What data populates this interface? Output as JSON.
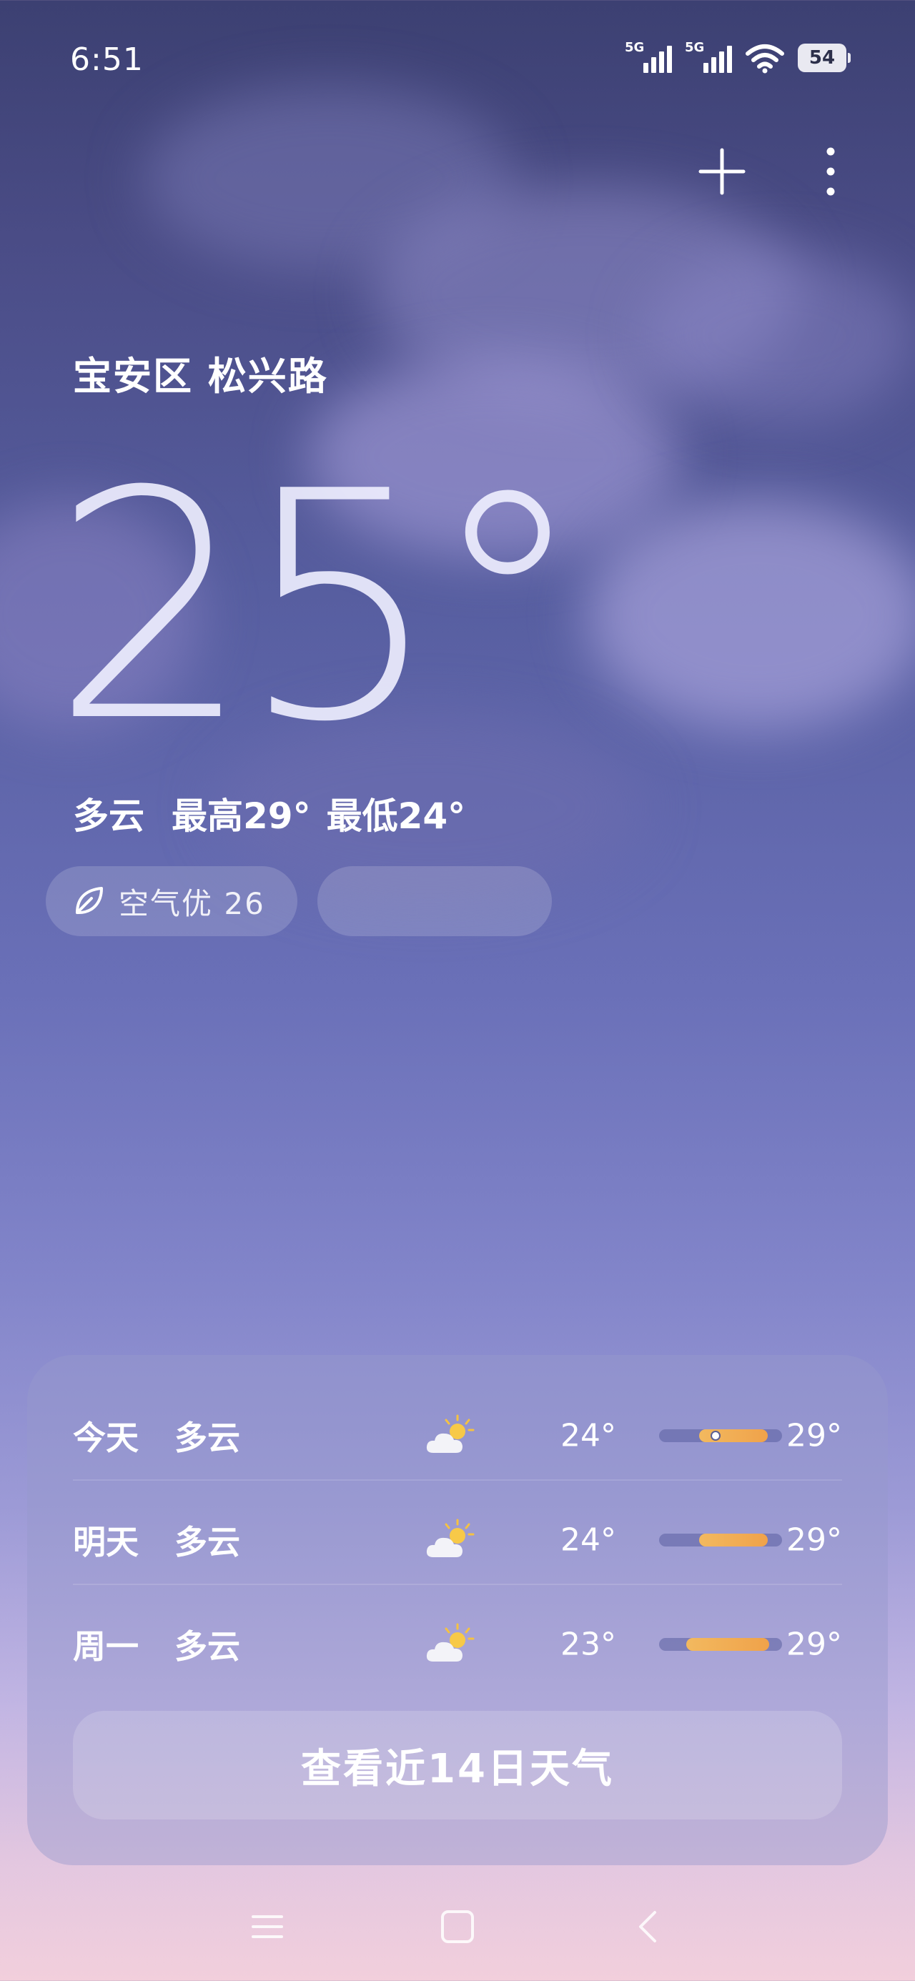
{
  "status_bar": {
    "time": "6:51",
    "sim1_tag": "5G",
    "sim2_tag": "5G",
    "battery": "54",
    "icons": [
      "signal-icon",
      "signal-icon",
      "wifi-icon",
      "battery-icon"
    ]
  },
  "toolbar": {
    "add_icon": "plus-icon",
    "more_icon": "more-vertical-icon"
  },
  "location": "宝安区 松兴路",
  "current": {
    "temperature": "25°",
    "condition": "多云",
    "high": "最高29°",
    "low": "最低24°",
    "aqi_label": "空气优 26",
    "aqi_icon": "leaf-icon",
    "secondary_pill_text": " "
  },
  "forecast": {
    "rows": [
      {
        "day": "今天",
        "condition": "多云",
        "icon": "partly-cloudy-icon",
        "low": "24°",
        "high": "29°",
        "current_marker": true
      },
      {
        "day": "明天",
        "condition": "多云",
        "icon": "partly-cloudy-icon",
        "low": "24°",
        "high": "29°",
        "current_marker": false
      },
      {
        "day": "周一",
        "condition": "多云",
        "icon": "partly-cloudy-icon",
        "low": "23°",
        "high": "29°",
        "current_marker": false
      }
    ],
    "button_label": "查看近14日天气"
  },
  "nav": {
    "icons": [
      "menu-icon",
      "home-icon",
      "back-icon"
    ]
  },
  "colors": {
    "bar_fill": "#f0a24a",
    "background_top": "#3c4072",
    "background_bottom": "#f2cfdc"
  }
}
